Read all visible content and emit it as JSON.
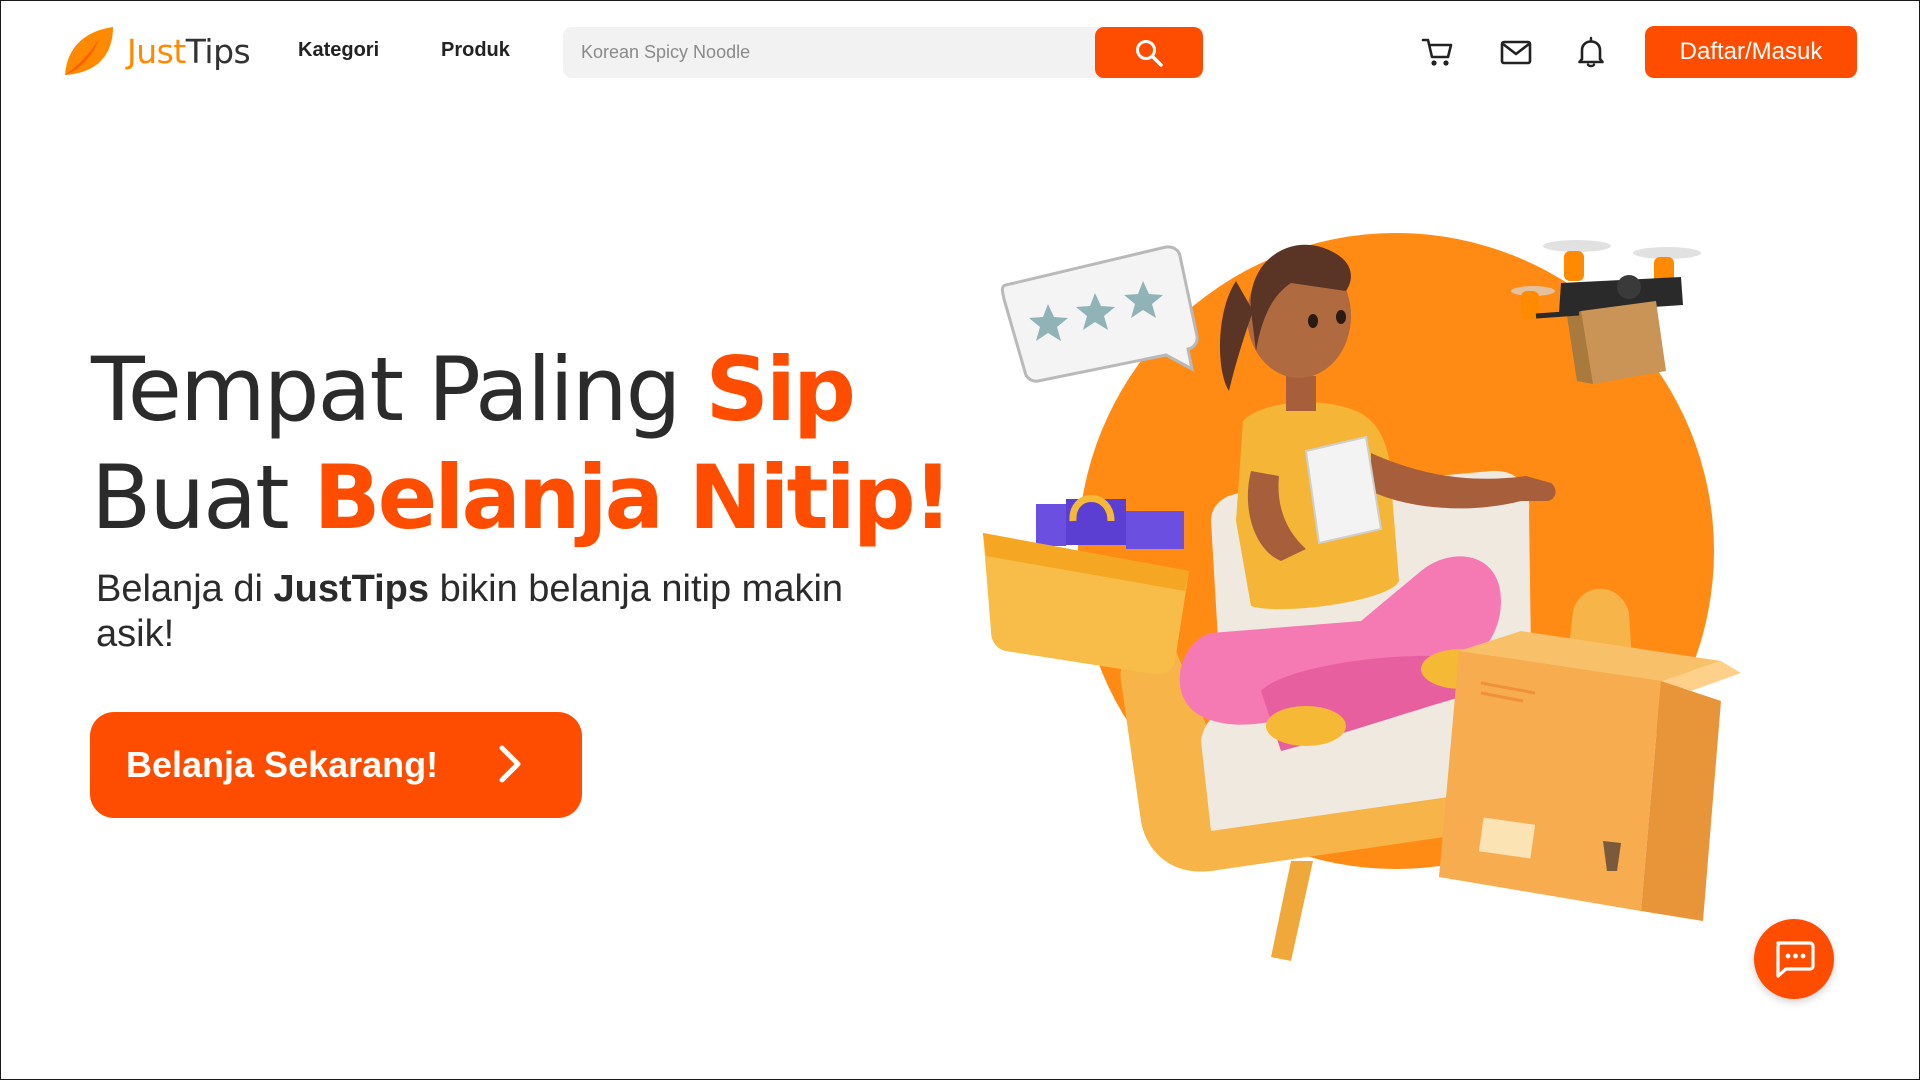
{
  "brand": {
    "name_part1": "Just",
    "name_part2": "Tips",
    "logo_icon": "leaf-logo-icon",
    "accent_color": "#ff4d00",
    "logo_color": "#ff8a00"
  },
  "nav": {
    "links": [
      {
        "label": "Kategori"
      },
      {
        "label": "Produk"
      }
    ],
    "search": {
      "placeholder": "Korean Spicy Noodle",
      "icon": "search-icon"
    },
    "icons": [
      "cart-icon",
      "mail-icon",
      "bell-icon"
    ],
    "auth_label": "Daftar/Masuk"
  },
  "hero": {
    "title_line1_normal": "Tempat Paling ",
    "title_line1_accent": "Sip",
    "title_line2_normal": "Buat ",
    "title_line2_accent": "Belanja Nitip!",
    "subtitle_pre": "Belanja di ",
    "subtitle_brand": "JustTips",
    "subtitle_post": " bikin belanja nitip makin asik!",
    "cta_label": "Belanja Sekarang!",
    "cta_icon": "chevron-right-icon"
  },
  "chat": {
    "icon": "chat-bubble-icon"
  }
}
